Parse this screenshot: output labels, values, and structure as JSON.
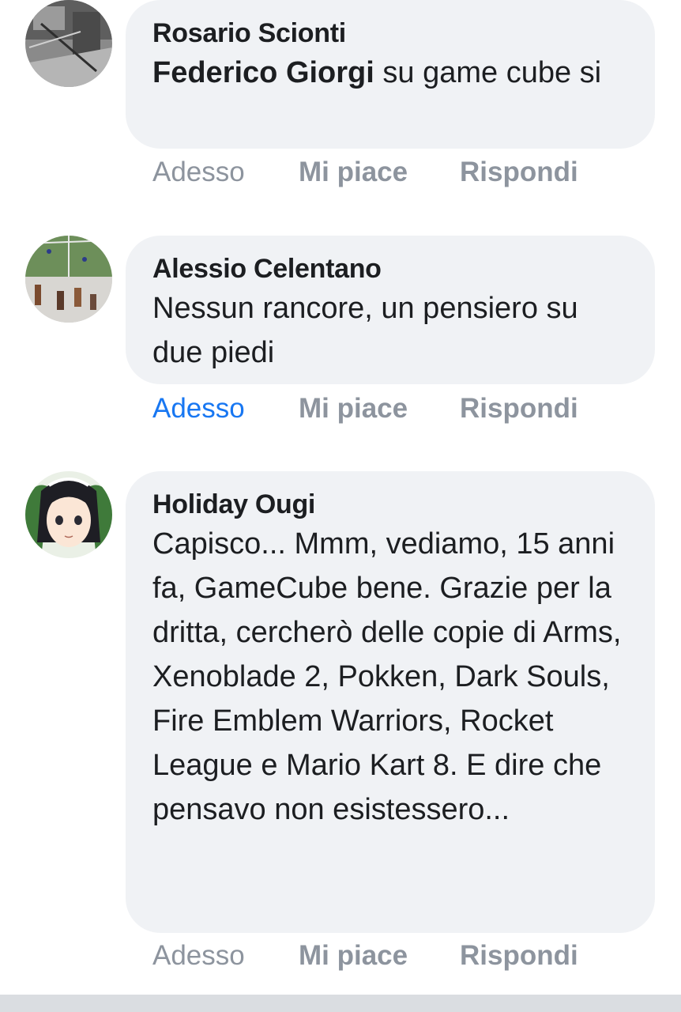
{
  "comments": [
    {
      "author": "Rosario Scionti",
      "mention": "Federico Giorgi",
      "text": " su game cube si",
      "time": "Adesso",
      "like": "Mi piace",
      "reply": "Rispondi",
      "avatar_icon": "grayscale-photo-avatar"
    },
    {
      "author": "Alessio Celentano",
      "mention": "",
      "text": "Nessun rancore, un pensiero su due piedi",
      "time": "Adesso",
      "like": "Mi piace",
      "reply": "Rispondi",
      "avatar_icon": "football-photo-avatar"
    },
    {
      "author": "Holiday Ougi",
      "mention": "",
      "text": "Capisco... Mmm, vediamo, 15 anni fa, GameCube bene. Grazie per la dritta, cercherò delle copie di Arms, Xenoblade 2, Pokken, Dark Souls, Fire Emblem Warriors, Rocket League e Mario Kart 8. E dire che pensavo non esistessero...",
      "time": "Adesso",
      "like": "Mi piace",
      "reply": "Rispondi",
      "avatar_icon": "anime-girl-avatar"
    }
  ],
  "colors": {
    "bubble": "#f0f2f5",
    "text": "#1c1e21",
    "muted": "#8d949e",
    "link": "#1877f2"
  }
}
